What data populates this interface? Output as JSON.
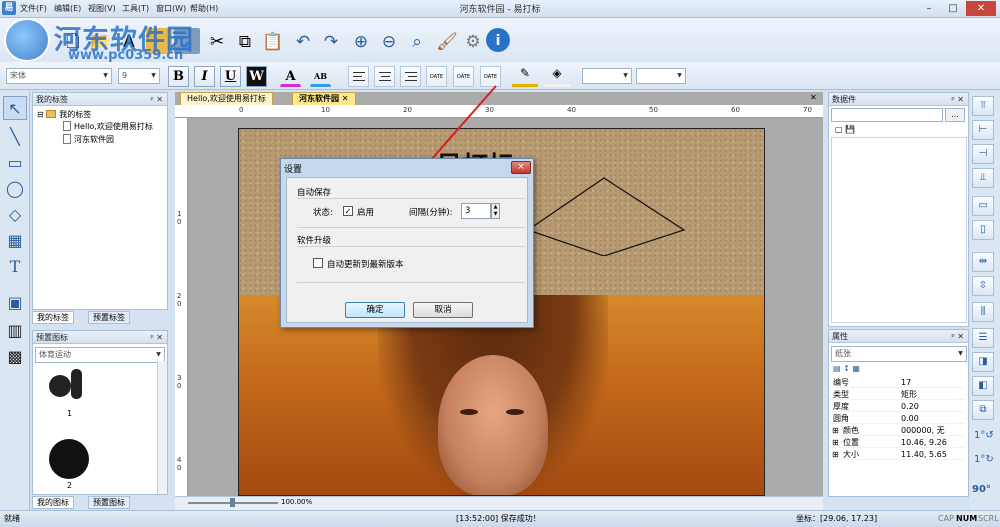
{
  "window": {
    "title": "河东软件园 - 易打标",
    "app_icon": "易"
  },
  "menu": [
    "文件(F)",
    "编辑(E)",
    "视图(V)",
    "工具(T)",
    "窗口(W)",
    "帮助(H)"
  ],
  "watermark": {
    "line1": "河东软件园",
    "line2": "www.pc0359.cn"
  },
  "font": {
    "family": "宋体",
    "size": "9"
  },
  "format_buttons": {
    "bold": "B",
    "italic": "I",
    "underline": "U",
    "wide": "W",
    "font_color": "A",
    "text_color": "AB",
    "date": "DATE"
  },
  "left_panel": {
    "title": "我的标签",
    "root": "我的标签",
    "items": [
      "Hello,欢迎使用易打标",
      "河东软件园"
    ],
    "tabs": [
      "我的标签",
      "预置标签"
    ]
  },
  "icon_panel": {
    "title": "预置图标",
    "category": "体育运动",
    "items": [
      "1",
      "2"
    ],
    "tabs": [
      "我的图标",
      "预置图标"
    ]
  },
  "doc_tabs": [
    "Hello,欢迎使用易打标",
    "河东软件园"
  ],
  "ruler": {
    "h": [
      "0",
      "10",
      "20",
      "30",
      "40",
      "50",
      "60",
      "70"
    ],
    "v": [
      "1",
      "0",
      "2",
      "0",
      "3",
      "0",
      "4",
      "0"
    ]
  },
  "canvas_text": "易打标",
  "zoom": "100.00%",
  "dialog": {
    "title": "设置",
    "close": "×",
    "autosave_group": "自动保存",
    "status_label": "状态:",
    "enable_label": "启用",
    "enable_checked": true,
    "interval_label": "间隔(分钟):",
    "interval_value": "3",
    "upgrade_group": "软件升级",
    "auto_update_label": "自动更新到最新版本",
    "auto_update_checked": false,
    "ok": "确定",
    "cancel": "取消"
  },
  "datasource_panel": {
    "title": "数据件",
    "btn": "..."
  },
  "props_panel": {
    "title": "属性",
    "object": "纸张",
    "rows": [
      {
        "k": "编号",
        "v": "17"
      },
      {
        "k": "类型",
        "v": "矩形"
      },
      {
        "k": "厚度",
        "v": "0.20"
      },
      {
        "k": "圆角",
        "v": "0.00"
      },
      {
        "k": "颜色",
        "v": "000000, 无"
      },
      {
        "k": "位置",
        "v": "10.46, 9.26"
      },
      {
        "k": "大小",
        "v": "11.40, 5.65"
      }
    ]
  },
  "rotate_labels": {
    "r1": "1°",
    "r90": "90°"
  },
  "status": {
    "left": "就绪",
    "center": "[13:52:00] 保存成功！",
    "coords": "坐标：[29.06, 17.23]",
    "cap": "CAP",
    "num": "NUM",
    "scrl": "SCRL"
  },
  "colors": {
    "accent": "#2a72c8",
    "dialog_bg": "#c6d8ee",
    "tab_active": "#ffe889"
  }
}
